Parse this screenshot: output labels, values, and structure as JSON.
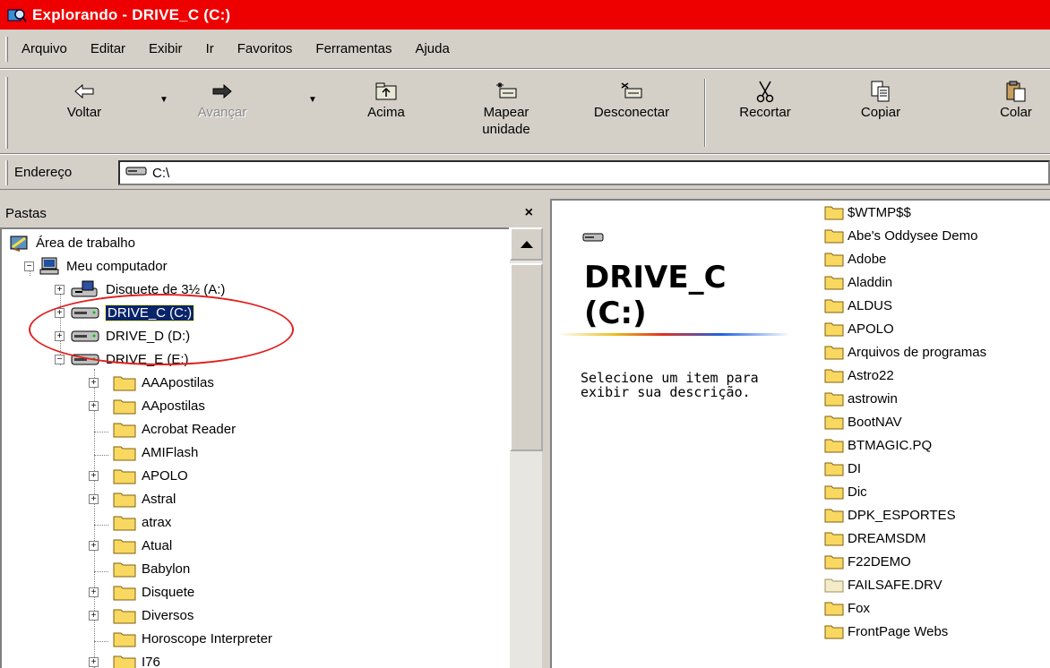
{
  "window": {
    "title": "Explorando - DRIVE_C (C:)"
  },
  "menu": [
    "Arquivo",
    "Editar",
    "Exibir",
    "Ir",
    "Favoritos",
    "Ferramentas",
    "Ajuda"
  ],
  "toolbar": {
    "back": "Voltar",
    "forward": "Avançar",
    "up": "Acima",
    "map_drive_1": "Mapear",
    "map_drive_2": "unidade",
    "disconnect": "Desconectar",
    "cut": "Recortar",
    "copy": "Copiar",
    "paste": "Colar"
  },
  "address": {
    "label": "Endereço",
    "value": "C:\\"
  },
  "folders_pane": {
    "title": "Pastas",
    "close": "×",
    "tree": [
      {
        "label": "Área de trabalho",
        "icon": "desktop-icon"
      },
      {
        "label": "Meu computador",
        "icon": "computer-icon"
      },
      {
        "label": "Disquete de 3½ (A:)",
        "icon": "floppy-drive-icon"
      },
      {
        "label": "DRIVE_C (C:)",
        "icon": "hard-drive-icon",
        "selected": true
      },
      {
        "label": "DRIVE_D (D:)",
        "icon": "hard-drive-icon"
      },
      {
        "label": "DRIVE_E (E:)",
        "icon": "hard-drive-icon"
      },
      {
        "label": "AAApostilas",
        "icon": "folder-icon"
      },
      {
        "label": "AApostilas",
        "icon": "folder-icon"
      },
      {
        "label": "Acrobat Reader",
        "icon": "folder-icon"
      },
      {
        "label": "AMIFlash",
        "icon": "folder-icon"
      },
      {
        "label": "APOLO",
        "icon": "folder-icon"
      },
      {
        "label": "Astral",
        "icon": "folder-icon"
      },
      {
        "label": "atrax",
        "icon": "folder-icon"
      },
      {
        "label": "Atual",
        "icon": "folder-icon"
      },
      {
        "label": "Babylon",
        "icon": "folder-icon"
      },
      {
        "label": "Disquete",
        "icon": "folder-icon"
      },
      {
        "label": "Diversos",
        "icon": "folder-icon"
      },
      {
        "label": "Horoscope Interpreter",
        "icon": "folder-icon"
      },
      {
        "label": "I76",
        "icon": "folder-icon"
      }
    ]
  },
  "drive_panel": {
    "title_line1": "DRIVE_C",
    "title_line2": "(C:)",
    "description": "Selecione um item para exibir sua descrição."
  },
  "files": [
    "$WTMP$$",
    "Abe's Oddysee Demo",
    "Adobe",
    "Aladdin",
    "ALDUS",
    "APOLO",
    "Arquivos de programas",
    "Astro22",
    "astrowin",
    "BootNAV",
    "BTMAGIC.PQ",
    "DI",
    "Dic",
    "DPK_ESPORTES",
    "DREAMSDM",
    "F22DEMO",
    "FAILSAFE.DRV",
    "Fox",
    "FrontPage Webs"
  ],
  "colors": {
    "titlebar": "#ee0000",
    "selection": "#0a246a",
    "highlight_ellipse": "#e02020",
    "folder": "#f8d860"
  }
}
